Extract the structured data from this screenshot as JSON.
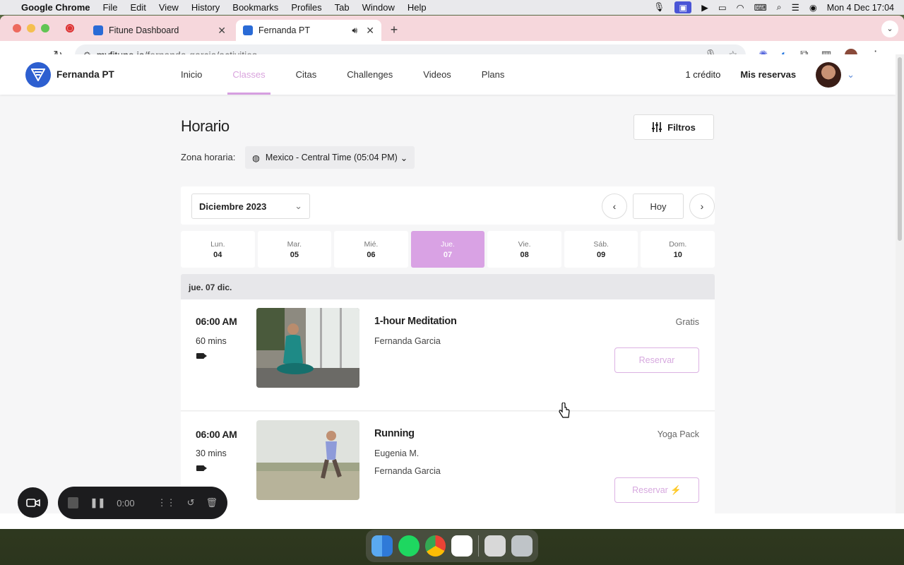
{
  "menubar": {
    "app_name": "Google Chrome",
    "items": [
      "File",
      "Edit",
      "View",
      "History",
      "Bookmarks",
      "Profiles",
      "Tab",
      "Window",
      "Help"
    ],
    "clock": "Mon 4 Dec  17:04"
  },
  "browser": {
    "tabs": [
      {
        "title": "Fitune Dashboard",
        "active": false
      },
      {
        "title": "Fernanda PT",
        "active": true
      }
    ],
    "url_host": "myfitune.io",
    "url_path": "/fernanda-garcia/activities"
  },
  "site": {
    "brand": "Fernanda PT",
    "nav": [
      "Inicio",
      "Classes",
      "Citas",
      "Challenges",
      "Videos",
      "Plans"
    ],
    "active_nav": "Classes",
    "credits": "1 crédito",
    "reservations": "Mis reservas",
    "accent_color": "#d9a2e4"
  },
  "schedule": {
    "title": "Horario",
    "filters_label": "Filtros",
    "timezone_label": "Zona horaria:",
    "timezone_value": "Mexico - Central Time (05:04 PM)",
    "month": "Diciembre 2023",
    "today_label": "Hoy",
    "days": [
      {
        "name": "Lun.",
        "num": "04"
      },
      {
        "name": "Mar.",
        "num": "05"
      },
      {
        "name": "Mié.",
        "num": "06"
      },
      {
        "name": "Jue.",
        "num": "07",
        "selected": true
      },
      {
        "name": "Vie.",
        "num": "08"
      },
      {
        "name": "Sáb.",
        "num": "09"
      },
      {
        "name": "Dom.",
        "num": "10"
      }
    ],
    "date_heading": "jue. 07 dic.",
    "classes": [
      {
        "time": "06:00 AM",
        "duration": "60 mins",
        "name": "1-hour Meditation",
        "coaches": [
          "Fernanda Garcia"
        ],
        "price": "Gratis",
        "button": "Reservar"
      },
      {
        "time": "06:00 AM",
        "duration": "30 mins",
        "name": "Running",
        "coaches": [
          "Eugenia M.",
          "Fernanda Garcia"
        ],
        "price": "Yoga Pack",
        "button": "Reservar ⚡"
      }
    ]
  },
  "recorder": {
    "elapsed": "0:00"
  }
}
